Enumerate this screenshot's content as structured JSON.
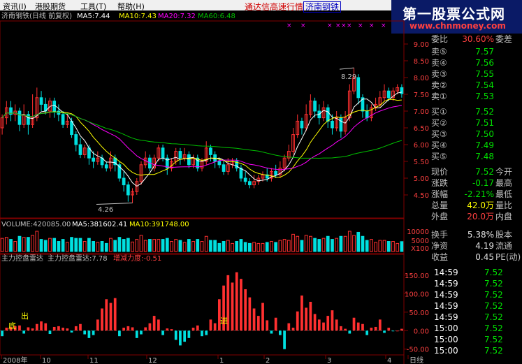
{
  "menu": [
    "资讯(I)",
    "港股期货",
    "工具(T)",
    "帮助(H)"
  ],
  "window_title": "通达信高速行情",
  "stock_tab": "济南钢铁",
  "logo": {
    "cn": "第一股票公式网",
    "url": "www.chnmoney.com"
  },
  "price_header": {
    "name": "济南钢铁(日线 前复权)",
    "ma5": "MA5:7.44",
    "ma10": "MA10:7.43",
    "ma20": "MA20:7.32",
    "ma60": "MA60:6.48"
  },
  "volume_header": {
    "vol": "VOLUME:420085.00",
    "ma5": "MA5:381602.41",
    "ma10": "MA10:391748.00"
  },
  "indicator_header": {
    "name": "主力控盘雷达",
    "val": "主力控盘雷达:7.78",
    "delta": "增减力度:-0.51"
  },
  "price_axis": [
    "9.00",
    "8.50",
    "8.00",
    "7.50",
    "7.00",
    "6.50",
    "6.00",
    "5.50",
    "5.00",
    "4.50"
  ],
  "volume_axis": [
    "10000",
    "5000",
    "X100"
  ],
  "indicator_axis": [
    "150.00",
    "100.00",
    "50.00",
    "0.00",
    "-50.00"
  ],
  "date_axis": [
    "2008年",
    "10",
    "11",
    "12",
    "1",
    "2",
    "3",
    "4",
    "日线"
  ],
  "annotations": {
    "high": "8.29",
    "low": "4.26"
  },
  "indicator_labels": {
    "di": "底",
    "chu": "出",
    "jin": "进"
  },
  "colors": {
    "up": "#ff3030",
    "down": "#00e0e0",
    "ma5": "#ffffff",
    "ma10": "#ffff00",
    "ma20": "#ff00ff",
    "ma60": "#00c000",
    "grid": "#800000",
    "logo_bg": "#0a1a66"
  },
  "order_book": {
    "ratio": {
      "label": "委比",
      "value": "30.60%",
      "tail": "委差"
    },
    "asks": [
      {
        "label": "卖⑤",
        "price": "7.57"
      },
      {
        "label": "卖④",
        "price": "7.56"
      },
      {
        "label": "卖③",
        "price": "7.55"
      },
      {
        "label": "卖②",
        "price": "7.54"
      },
      {
        "label": "卖①",
        "price": "7.53"
      }
    ],
    "bids": [
      {
        "label": "买①",
        "price": "7.52"
      },
      {
        "label": "买②",
        "price": "7.51"
      },
      {
        "label": "买③",
        "price": "7.50"
      },
      {
        "label": "买④",
        "price": "7.49"
      },
      {
        "label": "买⑤",
        "price": "7.48"
      }
    ]
  },
  "quote": [
    {
      "label": "现价",
      "value": "7.52",
      "tail": "今开",
      "color": "green"
    },
    {
      "label": "涨跌",
      "value": "-0.17",
      "tail": "最高",
      "color": "green"
    },
    {
      "label": "涨幅",
      "value": "-2.21%",
      "tail": "最低",
      "color": "green"
    },
    {
      "label": "总量",
      "value": "42.0万",
      "tail": "量比",
      "color": "yellow"
    },
    {
      "label": "外盘",
      "value": "20.0万",
      "tail": "内盘",
      "color": "red"
    },
    {
      "label": "换手",
      "value": "5.38%",
      "tail": "股本",
      "color": "white"
    },
    {
      "label": "净资",
      "value": "4.19",
      "tail": "流通",
      "color": "white"
    },
    {
      "label": "收益",
      "value": "0.45",
      "tail": "PE(动)",
      "color": "white"
    }
  ],
  "ticks": [
    {
      "time": "14:59",
      "price": "7.52"
    },
    {
      "time": "14:59",
      "price": "7.52"
    },
    {
      "time": "14:59",
      "price": "7.52"
    },
    {
      "time": "14:59",
      "price": "7.52"
    },
    {
      "time": "14:59",
      "price": "7.52"
    },
    {
      "time": "15:00",
      "price": "7.52"
    },
    {
      "time": "15:00",
      "price": "7.52"
    },
    {
      "time": "15:00",
      "price": "7.52"
    }
  ],
  "chart_data": {
    "type": "candlestick",
    "price_range": [
      4.0,
      9.5
    ],
    "candles": [
      [
        6.5,
        6.8,
        6.9,
        6.3
      ],
      [
        6.8,
        7.1,
        7.3,
        6.6
      ],
      [
        7.1,
        6.9,
        7.3,
        6.7
      ],
      [
        6.9,
        7.0,
        7.2,
        6.7
      ],
      [
        7.0,
        6.6,
        7.1,
        6.4
      ],
      [
        6.6,
        6.9,
        7.2,
        6.5
      ],
      [
        6.9,
        6.6,
        7.0,
        6.3
      ],
      [
        6.6,
        6.8,
        7.5,
        6.5
      ],
      [
        6.8,
        7.4,
        7.7,
        6.7
      ],
      [
        7.4,
        7.2,
        7.6,
        7.0
      ],
      [
        7.2,
        7.0,
        7.4,
        6.9
      ],
      [
        7.0,
        7.3,
        7.4,
        6.8
      ],
      [
        7.3,
        7.0,
        7.4,
        6.8
      ],
      [
        7.0,
        6.9,
        7.2,
        6.7
      ],
      [
        6.9,
        6.6,
        7.0,
        6.5
      ],
      [
        6.6,
        6.7,
        6.9,
        6.5
      ],
      [
        6.7,
        6.3,
        6.8,
        6.2
      ],
      [
        6.3,
        6.0,
        6.4,
        5.8
      ],
      [
        6.0,
        5.7,
        6.2,
        5.6
      ],
      [
        5.7,
        5.9,
        6.0,
        5.6
      ],
      [
        5.9,
        5.6,
        6.0,
        5.4
      ],
      [
        5.6,
        5.5,
        5.8,
        5.3
      ],
      [
        5.5,
        5.6,
        5.8,
        5.4
      ],
      [
        5.6,
        5.4,
        5.7,
        5.3
      ],
      [
        5.4,
        5.3,
        5.5,
        5.2
      ],
      [
        5.3,
        5.6,
        5.8,
        5.2
      ],
      [
        5.6,
        5.4,
        5.7,
        5.2
      ],
      [
        5.4,
        5.0,
        5.5,
        4.9
      ],
      [
        5.0,
        4.8,
        5.2,
        4.6
      ],
      [
        4.8,
        4.5,
        4.9,
        4.3
      ],
      [
        4.5,
        4.6,
        4.7,
        4.26
      ],
      [
        4.6,
        4.9,
        5.0,
        4.5
      ],
      [
        4.9,
        5.4,
        5.5,
        4.8
      ],
      [
        5.4,
        5.6,
        5.8,
        5.3
      ],
      [
        5.6,
        5.3,
        5.7,
        5.2
      ],
      [
        5.3,
        5.6,
        5.7,
        5.2
      ],
      [
        5.6,
        5.9,
        6.0,
        5.5
      ],
      [
        5.9,
        5.6,
        6.0,
        5.5
      ],
      [
        5.6,
        5.3,
        5.7,
        5.1
      ],
      [
        5.3,
        5.5,
        5.6,
        5.2
      ],
      [
        5.5,
        5.8,
        5.9,
        5.4
      ],
      [
        5.8,
        5.6,
        5.9,
        5.4
      ],
      [
        5.6,
        5.7,
        5.9,
        5.5
      ],
      [
        5.7,
        5.4,
        5.8,
        5.3
      ],
      [
        5.4,
        5.6,
        5.7,
        5.3
      ],
      [
        5.6,
        5.3,
        5.7,
        5.2
      ],
      [
        5.3,
        5.5,
        5.6,
        5.2
      ],
      [
        5.5,
        5.9,
        6.1,
        5.4
      ],
      [
        5.9,
        5.7,
        6.0,
        5.5
      ],
      [
        5.7,
        5.5,
        5.8,
        5.3
      ],
      [
        5.5,
        5.4,
        5.6,
        5.3
      ],
      [
        5.4,
        5.2,
        5.5,
        5.1
      ],
      [
        5.2,
        5.4,
        5.6,
        5.1
      ],
      [
        5.4,
        5.5,
        5.6,
        5.3
      ],
      [
        5.5,
        5.3,
        5.6,
        5.2
      ],
      [
        5.3,
        5.0,
        5.4,
        4.9
      ],
      [
        5.0,
        4.9,
        5.2,
        4.8
      ],
      [
        4.9,
        4.8,
        5.0,
        4.7
      ],
      [
        4.8,
        4.9,
        5.1,
        4.7
      ],
      [
        4.9,
        5.0,
        5.1,
        4.8
      ],
      [
        5.0,
        5.1,
        5.2,
        4.9
      ],
      [
        5.1,
        5.0,
        5.3,
        4.9
      ],
      [
        5.0,
        5.2,
        5.3,
        4.9
      ],
      [
        5.2,
        5.1,
        5.4,
        5.0
      ],
      [
        5.1,
        5.3,
        5.5,
        5.0
      ],
      [
        5.3,
        5.6,
        5.7,
        5.2
      ],
      [
        5.6,
        5.8,
        6.0,
        5.5
      ],
      [
        5.8,
        6.3,
        6.5,
        5.7
      ],
      [
        6.3,
        6.7,
        6.9,
        6.2
      ],
      [
        6.7,
        6.5,
        6.8,
        6.3
      ],
      [
        6.5,
        6.9,
        7.2,
        6.4
      ],
      [
        6.9,
        7.3,
        7.5,
        6.8
      ],
      [
        7.3,
        7.0,
        7.4,
        6.8
      ],
      [
        7.0,
        6.8,
        7.2,
        6.6
      ],
      [
        6.8,
        7.1,
        7.3,
        6.7
      ],
      [
        7.1,
        6.7,
        7.2,
        6.5
      ],
      [
        6.7,
        6.5,
        6.9,
        6.3
      ],
      [
        6.5,
        6.8,
        7.0,
        6.4
      ],
      [
        6.8,
        6.4,
        6.9,
        6.2
      ],
      [
        6.4,
        6.8,
        7.0,
        6.3
      ],
      [
        6.8,
        7.6,
        7.8,
        6.7
      ],
      [
        7.6,
        8.0,
        8.29,
        7.5
      ],
      [
        8.0,
        7.4,
        8.1,
        7.2
      ],
      [
        7.4,
        7.0,
        7.5,
        6.8
      ],
      [
        7.0,
        6.8,
        7.2,
        6.7
      ],
      [
        6.8,
        7.1,
        7.2,
        6.7
      ],
      [
        7.1,
        7.2,
        7.4,
        7.0
      ],
      [
        7.2,
        7.4,
        7.6,
        7.1
      ],
      [
        7.4,
        7.6,
        7.8,
        7.3
      ],
      [
        7.6,
        7.4,
        7.7,
        7.3
      ],
      [
        7.4,
        7.6,
        7.7,
        7.3
      ],
      [
        7.6,
        7.7,
        7.8,
        7.5
      ],
      [
        7.7,
        7.52,
        7.8,
        7.4
      ]
    ],
    "ma_periods": [
      5,
      10,
      20,
      60
    ],
    "last_ma": {
      "ma5": 7.44,
      "ma10": 7.43,
      "ma20": 7.32,
      "ma60": 6.48
    },
    "volume_axis_max": 11000,
    "volume_last": 4200,
    "indicator_range": [
      -60,
      180
    ],
    "indicator_values": [
      -15,
      8,
      10,
      12,
      14,
      -8,
      9,
      6,
      18,
      25,
      20,
      -9,
      10,
      12,
      8,
      6,
      -5,
      12,
      18,
      -10,
      -20,
      -12,
      30,
      60,
      85,
      75,
      88,
      -15,
      8,
      12,
      9,
      -20,
      -10,
      9,
      20,
      40,
      30,
      -12,
      6,
      4,
      -25,
      -40,
      -30,
      -20,
      8,
      14,
      -15,
      -12,
      30,
      20,
      85,
      122,
      150,
      130,
      158,
      140,
      112,
      90,
      60,
      40,
      75,
      28,
      -8,
      35,
      -12,
      -50,
      20,
      8,
      52,
      95,
      62,
      78,
      45,
      30,
      22,
      40,
      55,
      30,
      12,
      5,
      -8,
      35,
      22,
      18,
      -12,
      8,
      10,
      30,
      -6,
      7.78,
      -0.51,
      0,
      5
    ]
  }
}
